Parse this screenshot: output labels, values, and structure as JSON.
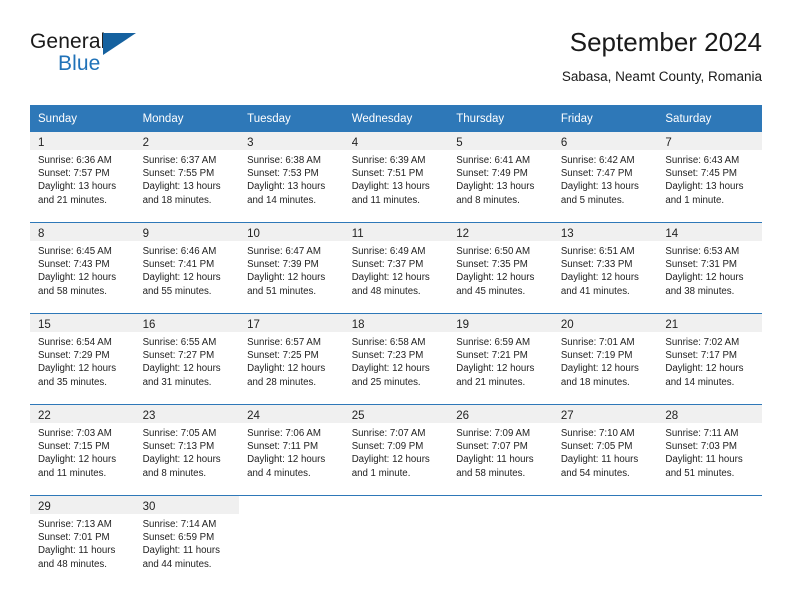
{
  "brand": {
    "word_one": "General",
    "word_two": "Blue",
    "flag_icon": "triangle-flag-icon"
  },
  "header": {
    "title": "September 2024",
    "subtitle": "Sabasa, Neamt County, Romania"
  },
  "colors": {
    "header_blue": "#2e78b8",
    "brand_blue": "#2072b8",
    "flag_blue": "#15619f",
    "daynum_band": "#f0f0f0",
    "text": "#222222"
  },
  "weekday_headers": [
    "Sunday",
    "Monday",
    "Tuesday",
    "Wednesday",
    "Thursday",
    "Friday",
    "Saturday"
  ],
  "weeks": [
    [
      {
        "day": "1",
        "lines": [
          "Sunrise: 6:36 AM",
          "Sunset: 7:57 PM",
          "Daylight: 13 hours",
          "and 21 minutes."
        ]
      },
      {
        "day": "2",
        "lines": [
          "Sunrise: 6:37 AM",
          "Sunset: 7:55 PM",
          "Daylight: 13 hours",
          "and 18 minutes."
        ]
      },
      {
        "day": "3",
        "lines": [
          "Sunrise: 6:38 AM",
          "Sunset: 7:53 PM",
          "Daylight: 13 hours",
          "and 14 minutes."
        ]
      },
      {
        "day": "4",
        "lines": [
          "Sunrise: 6:39 AM",
          "Sunset: 7:51 PM",
          "Daylight: 13 hours",
          "and 11 minutes."
        ]
      },
      {
        "day": "5",
        "lines": [
          "Sunrise: 6:41 AM",
          "Sunset: 7:49 PM",
          "Daylight: 13 hours",
          "and 8 minutes."
        ]
      },
      {
        "day": "6",
        "lines": [
          "Sunrise: 6:42 AM",
          "Sunset: 7:47 PM",
          "Daylight: 13 hours",
          "and 5 minutes."
        ]
      },
      {
        "day": "7",
        "lines": [
          "Sunrise: 6:43 AM",
          "Sunset: 7:45 PM",
          "Daylight: 13 hours",
          "and 1 minute."
        ]
      }
    ],
    [
      {
        "day": "8",
        "lines": [
          "Sunrise: 6:45 AM",
          "Sunset: 7:43 PM",
          "Daylight: 12 hours",
          "and 58 minutes."
        ]
      },
      {
        "day": "9",
        "lines": [
          "Sunrise: 6:46 AM",
          "Sunset: 7:41 PM",
          "Daylight: 12 hours",
          "and 55 minutes."
        ]
      },
      {
        "day": "10",
        "lines": [
          "Sunrise: 6:47 AM",
          "Sunset: 7:39 PM",
          "Daylight: 12 hours",
          "and 51 minutes."
        ]
      },
      {
        "day": "11",
        "lines": [
          "Sunrise: 6:49 AM",
          "Sunset: 7:37 PM",
          "Daylight: 12 hours",
          "and 48 minutes."
        ]
      },
      {
        "day": "12",
        "lines": [
          "Sunrise: 6:50 AM",
          "Sunset: 7:35 PM",
          "Daylight: 12 hours",
          "and 45 minutes."
        ]
      },
      {
        "day": "13",
        "lines": [
          "Sunrise: 6:51 AM",
          "Sunset: 7:33 PM",
          "Daylight: 12 hours",
          "and 41 minutes."
        ]
      },
      {
        "day": "14",
        "lines": [
          "Sunrise: 6:53 AM",
          "Sunset: 7:31 PM",
          "Daylight: 12 hours",
          "and 38 minutes."
        ]
      }
    ],
    [
      {
        "day": "15",
        "lines": [
          "Sunrise: 6:54 AM",
          "Sunset: 7:29 PM",
          "Daylight: 12 hours",
          "and 35 minutes."
        ]
      },
      {
        "day": "16",
        "lines": [
          "Sunrise: 6:55 AM",
          "Sunset: 7:27 PM",
          "Daylight: 12 hours",
          "and 31 minutes."
        ]
      },
      {
        "day": "17",
        "lines": [
          "Sunrise: 6:57 AM",
          "Sunset: 7:25 PM",
          "Daylight: 12 hours",
          "and 28 minutes."
        ]
      },
      {
        "day": "18",
        "lines": [
          "Sunrise: 6:58 AM",
          "Sunset: 7:23 PM",
          "Daylight: 12 hours",
          "and 25 minutes."
        ]
      },
      {
        "day": "19",
        "lines": [
          "Sunrise: 6:59 AM",
          "Sunset: 7:21 PM",
          "Daylight: 12 hours",
          "and 21 minutes."
        ]
      },
      {
        "day": "20",
        "lines": [
          "Sunrise: 7:01 AM",
          "Sunset: 7:19 PM",
          "Daylight: 12 hours",
          "and 18 minutes."
        ]
      },
      {
        "day": "21",
        "lines": [
          "Sunrise: 7:02 AM",
          "Sunset: 7:17 PM",
          "Daylight: 12 hours",
          "and 14 minutes."
        ]
      }
    ],
    [
      {
        "day": "22",
        "lines": [
          "Sunrise: 7:03 AM",
          "Sunset: 7:15 PM",
          "Daylight: 12 hours",
          "and 11 minutes."
        ]
      },
      {
        "day": "23",
        "lines": [
          "Sunrise: 7:05 AM",
          "Sunset: 7:13 PM",
          "Daylight: 12 hours",
          "and 8 minutes."
        ]
      },
      {
        "day": "24",
        "lines": [
          "Sunrise: 7:06 AM",
          "Sunset: 7:11 PM",
          "Daylight: 12 hours",
          "and 4 minutes."
        ]
      },
      {
        "day": "25",
        "lines": [
          "Sunrise: 7:07 AM",
          "Sunset: 7:09 PM",
          "Daylight: 12 hours",
          "and 1 minute."
        ]
      },
      {
        "day": "26",
        "lines": [
          "Sunrise: 7:09 AM",
          "Sunset: 7:07 PM",
          "Daylight: 11 hours",
          "and 58 minutes."
        ]
      },
      {
        "day": "27",
        "lines": [
          "Sunrise: 7:10 AM",
          "Sunset: 7:05 PM",
          "Daylight: 11 hours",
          "and 54 minutes."
        ]
      },
      {
        "day": "28",
        "lines": [
          "Sunrise: 7:11 AM",
          "Sunset: 7:03 PM",
          "Daylight: 11 hours",
          "and 51 minutes."
        ]
      }
    ],
    [
      {
        "day": "29",
        "lines": [
          "Sunrise: 7:13 AM",
          "Sunset: 7:01 PM",
          "Daylight: 11 hours",
          "and 48 minutes."
        ]
      },
      {
        "day": "30",
        "lines": [
          "Sunrise: 7:14 AM",
          "Sunset: 6:59 PM",
          "Daylight: 11 hours",
          "and 44 minutes."
        ]
      },
      {
        "day": "",
        "lines": []
      },
      {
        "day": "",
        "lines": []
      },
      {
        "day": "",
        "lines": []
      },
      {
        "day": "",
        "lines": []
      },
      {
        "day": "",
        "lines": []
      }
    ]
  ]
}
